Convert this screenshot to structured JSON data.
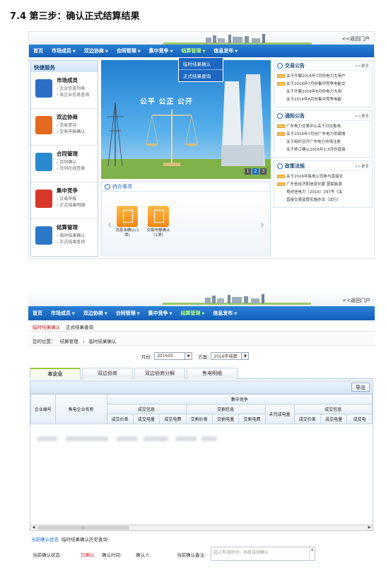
{
  "doc_title": "7.4  第三步：确认正式结算结果",
  "header": {
    "return_link": "<<返回门户"
  },
  "nav": [
    {
      "label": "首页"
    },
    {
      "label": "市场成员",
      "caret": "▼"
    },
    {
      "label": "双边协商",
      "caret": "▼"
    },
    {
      "label": "合同管理",
      "caret": "▼"
    },
    {
      "label": "集中竞争",
      "caret": "▼"
    },
    {
      "label": "结算管理",
      "caret": "▼"
    },
    {
      "label": "信息发布",
      "caret": "▼"
    }
  ],
  "dropdown": [
    "临时结果确认",
    "正式结果查询"
  ],
  "quick_services": {
    "title": "快捷服务",
    "items": [
      {
        "name": "市场成员",
        "subs": [
          "› 企业信息列表",
          "› 本企业信息查询"
        ],
        "color": "#2b6fc6"
      },
      {
        "name": "双边协商",
        "subs": [
          "› 交易意向",
          "› 交易申报确认"
        ],
        "color": "#e46a1e"
      },
      {
        "name": "合同管理",
        "subs": [
          "› 合同确认",
          "› 合同在线签章"
        ],
        "color": "#2a8ad0"
      },
      {
        "name": "集中竞争",
        "subs": [
          "› 交易申报",
          "› 正式结果明细"
        ],
        "color": "#d7382a"
      },
      {
        "name": "结算管理",
        "subs": [
          "› 临时结果确认",
          "› 正式结果查询"
        ],
        "color": "#2b78c8"
      }
    ]
  },
  "banner": {
    "slogan": "公平  公正  公开",
    "pager": [
      "1",
      "2",
      "3"
    ]
  },
  "todo": {
    "title": "待办事项",
    "cards": [
      {
        "label": "消息未确认(1项)"
      },
      {
        "label": "交易申报确认(1项)"
      }
    ]
  },
  "news": [
    {
      "title": "交易公告",
      "more": ">>更多",
      "rows": [
        {
          "new": true,
          "text": "关于开展2016年7月份电力大用户"
        },
        {
          "new": true,
          "text": "关于2016年7月份集中竞争电能交"
        },
        {
          "new": false,
          "text": "关于开展2016年8月份电力大用"
        },
        {
          "new": false,
          "text": "关于2016年8月份集中竞争电能"
        }
      ]
    },
    {
      "title": "通知公告",
      "more": ">>更多",
      "rows": [
        {
          "new": true,
          "text": "广东电力交易中心关于讨论售电"
        },
        {
          "new": true,
          "text": "关于2016年7月份广东电力供需情"
        },
        {
          "new": false,
          "text": "关于组织召开广东电力市场注册"
        },
        {
          "new": false,
          "text": "关于修订确认2016年1-3月份直接"
        }
      ]
    },
    {
      "title": "政策法规",
      "more": ">>更多",
      "rows": [
        {
          "new": true,
          "text": "关于2016年售电公司参与直接交"
        },
        {
          "new": true,
          "text": "广东省经济和信息化委 国家能源"
        },
        {
          "new": false,
          "text": "粤经信电力〔2016〕297号《关"
        },
        {
          "new": false,
          "text": "直接交易监管实施办法（试行）"
        }
      ]
    }
  ],
  "screen2": {
    "subnav": [
      "临时结果确认",
      "正式结果查询"
    ],
    "breadcrumb": [
      "您的位置：",
      "结算管理",
      "›",
      "临时结果确认"
    ],
    "filter": {
      "month_label": "月份:",
      "month_value": "201605",
      "scheme_label": "方案:",
      "scheme_value": "2016年结算"
    },
    "tabs": [
      "本企业",
      "双边协商",
      "双边协商分解",
      "售电明细"
    ],
    "export_label": "导出",
    "grid": {
      "group_label": "集中竞争",
      "col_company_id": "企业编号",
      "col_company_name": "售电企业名称",
      "sub_groups": [
        "成交信息",
        "交割信息",
        "未完成电量",
        "成交信息"
      ],
      "cols_deal": [
        "成交价差",
        "成交电量",
        "成交电费"
      ],
      "cols_delivery": [
        "交割价差",
        "交割电量",
        "交割电费"
      ],
      "cols_deal2": [
        "成交价差",
        "成交电量",
        "成交电"
      ]
    },
    "scroll_thumb": "III",
    "status_tabs": [
      "当前确认状态",
      "临时结果确认历史查询"
    ],
    "status": {
      "state_label": "当前确认状态:",
      "state_value": "已确认",
      "time_label": "确认时间:",
      "person_label": "确认人:",
      "remark_label": "当前确认备注:",
      "remark_value": "超过有效时间，系统自动确认"
    }
  }
}
